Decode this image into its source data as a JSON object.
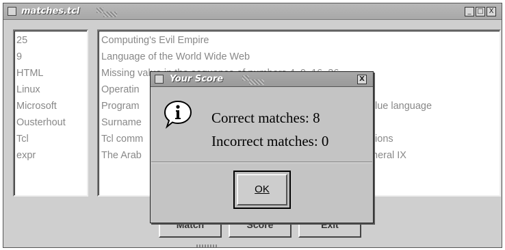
{
  "window": {
    "title": "matches.tcl",
    "controls": {
      "minimize": "_",
      "maximize": "□",
      "close": "X"
    }
  },
  "left_list": [
    "25",
    "9",
    "HTML",
    "Linux",
    "Microsoft",
    "Ousterhout",
    "Tcl",
    "expr"
  ],
  "right_list": [
    "Computing's Evil Empire",
    "Language of the World Wide Web",
    "Missing value in the sequence of numbers 4, 9, 16, 36",
    "Operatin",
    "Program",
    "Surname",
    "Tcl comm",
    "The Arab"
  ],
  "right_list_tails": {
    "row5": "lue language",
    "row7": "tions",
    "row8": "neral IX"
  },
  "buttons": {
    "match": "Match",
    "score": "Score",
    "exit": "Exit"
  },
  "dialog": {
    "title": "Your Score",
    "close": "X",
    "icon": "info-icon",
    "correct": "Correct matches: 8",
    "incorrect": "Incorrect matches: 0",
    "ok_label": "OK"
  }
}
